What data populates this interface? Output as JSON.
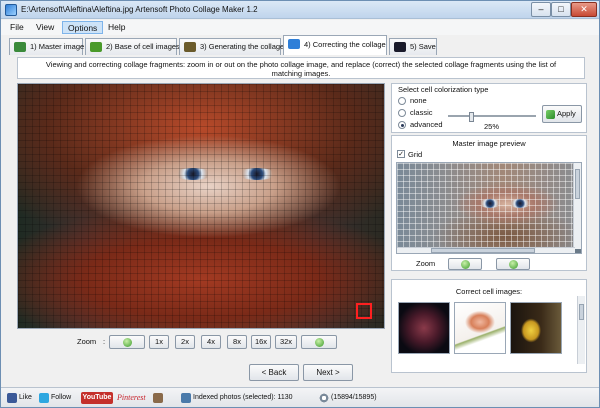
{
  "window": {
    "title": "E:\\Artensoft\\Aleftina\\Aleftina.jpg Artensoft Photo Collage Maker 1.2",
    "min": "–",
    "max": "□",
    "close": "✕"
  },
  "menu": [
    "File",
    "View",
    "Options",
    "Help"
  ],
  "tabs": [
    {
      "label": "1) Master image",
      "icon": "master-image-icon",
      "color": "#3a8a3a"
    },
    {
      "label": "2) Base of cell images",
      "icon": "cell-base-icon",
      "color": "#4a9a2a"
    },
    {
      "label": "3) Generating the collage",
      "icon": "magic-wand-icon",
      "color": "#6a5a2a"
    },
    {
      "label": "4) Correcting the collage",
      "icon": "cube-icon",
      "color": "#2f7fd8",
      "active": true
    },
    {
      "label": "5) Save",
      "icon": "floppy-icon",
      "color": "#1a1a2a"
    }
  ],
  "description": "Viewing and correcting collage fragments: zoom in or out on the photo collage image, and replace (correct) the selected collage fragments using the list of matching images.",
  "zoom": {
    "label": "Zoom",
    "separator": ":",
    "levels": [
      "1x",
      "2x",
      "4x",
      "8x",
      "16x",
      "32x"
    ]
  },
  "nav": {
    "back": "< Back",
    "next": "Next >"
  },
  "colorization": {
    "title": "Select cell colorization type",
    "options": [
      "none",
      "classic",
      "advanced"
    ],
    "selected": "advanced",
    "level_label": "25%",
    "level": 0.25,
    "apply": "Apply"
  },
  "preview": {
    "title": "Master image preview",
    "grid_label": "Grid",
    "grid_checked": true,
    "check_mark": "✓",
    "zoom_label": "Zoom"
  },
  "correct": {
    "title": "Correct cell images:",
    "thumbs": [
      "dark rose",
      "pink tulip",
      "yellow tulips"
    ]
  },
  "status": {
    "like": "Like",
    "follow": "Follow",
    "youtube": "YouTube",
    "pinterest": "Pinterest",
    "indexed": "Indexed photos (selected): 1130",
    "progress": "(15894/15895)"
  }
}
